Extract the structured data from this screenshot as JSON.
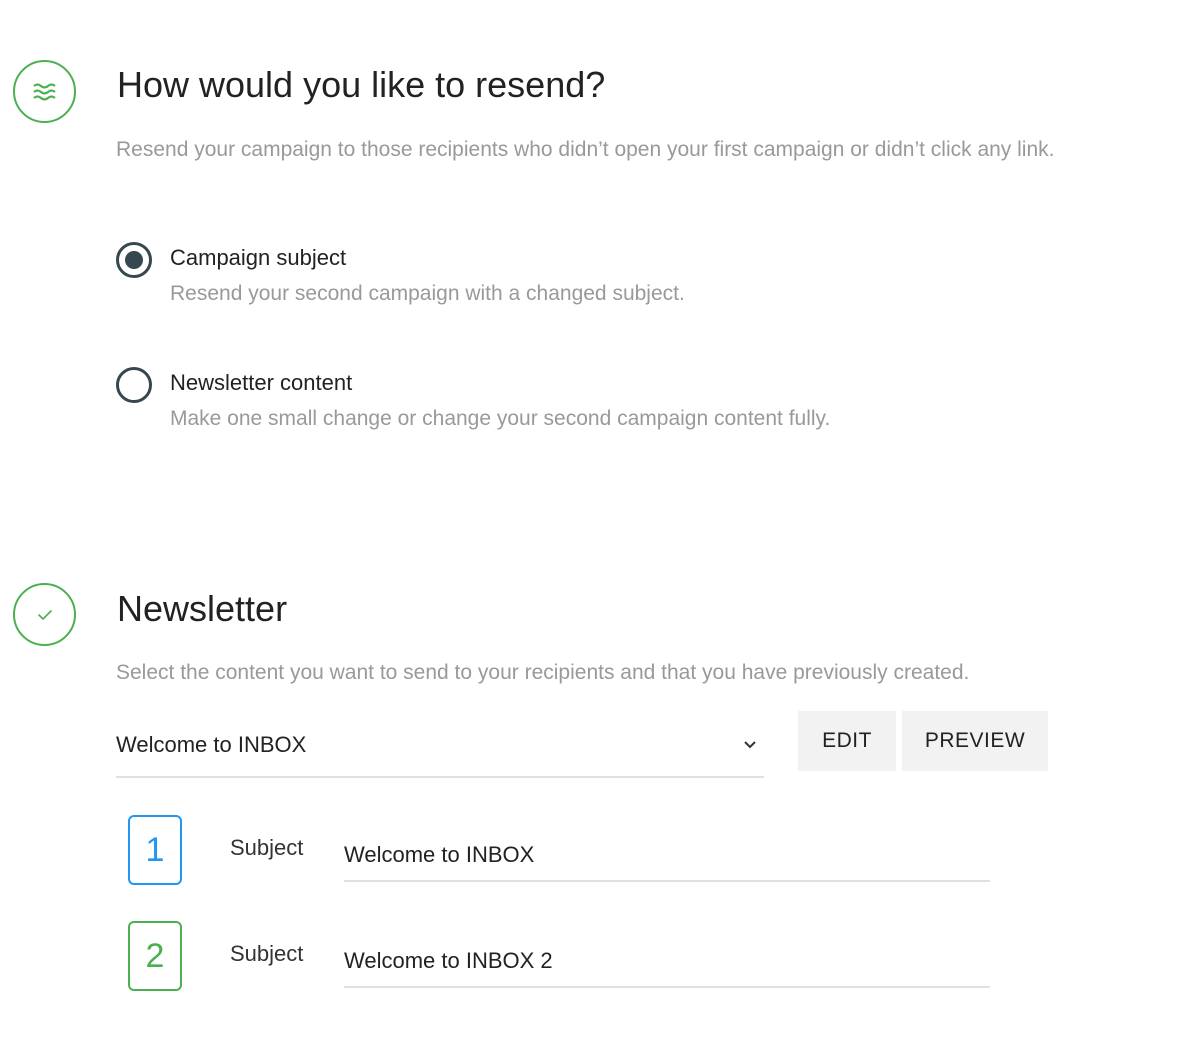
{
  "resend": {
    "icon": "waves-icon",
    "title": "How would you like to resend?",
    "description": "Resend your campaign to those recipients who didn’t open your first campaign or didn’t click any link.",
    "options": [
      {
        "label": "Campaign subject",
        "description": "Resend your second campaign with a changed subject.",
        "selected": true
      },
      {
        "label": "Newsletter content",
        "description": "Make one small change or change your second campaign content fully.",
        "selected": false
      }
    ]
  },
  "newsletter": {
    "icon": "check-icon",
    "title": "Newsletter",
    "description": "Select the content you want to send to your recipients and that you have previously created.",
    "selected_content": "Welcome to INBOX",
    "edit_label": "EDIT",
    "preview_label": "PREVIEW",
    "subjects": [
      {
        "number": "1",
        "label": "Subject",
        "value": "Welcome to INBOX",
        "color": "#2196f3"
      },
      {
        "number": "2",
        "label": "Subject",
        "value": "Welcome to INBOX 2",
        "color": "#4caf50"
      }
    ]
  },
  "colors": {
    "accent_green": "#4caf50",
    "accent_blue": "#2196f3",
    "radio_dark": "#37474f",
    "muted_text": "#999999"
  }
}
